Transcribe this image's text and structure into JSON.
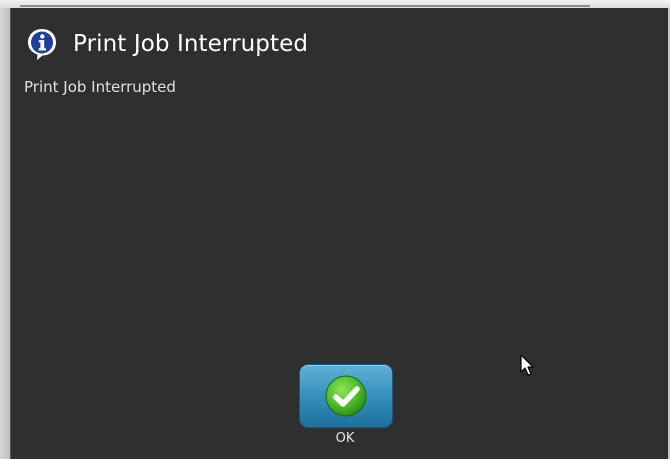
{
  "dialog": {
    "title": "Print Job Interrupted",
    "title_icon": "info-icon",
    "message": "Print Job Interrupted",
    "ok_button": {
      "icon": "checkmark-icon",
      "label": "OK"
    }
  },
  "colors": {
    "dialog_background": "#2f2f2f",
    "button_blue": "#3a93c0",
    "check_green": "#5cc735",
    "title_text": "#ffffff"
  }
}
